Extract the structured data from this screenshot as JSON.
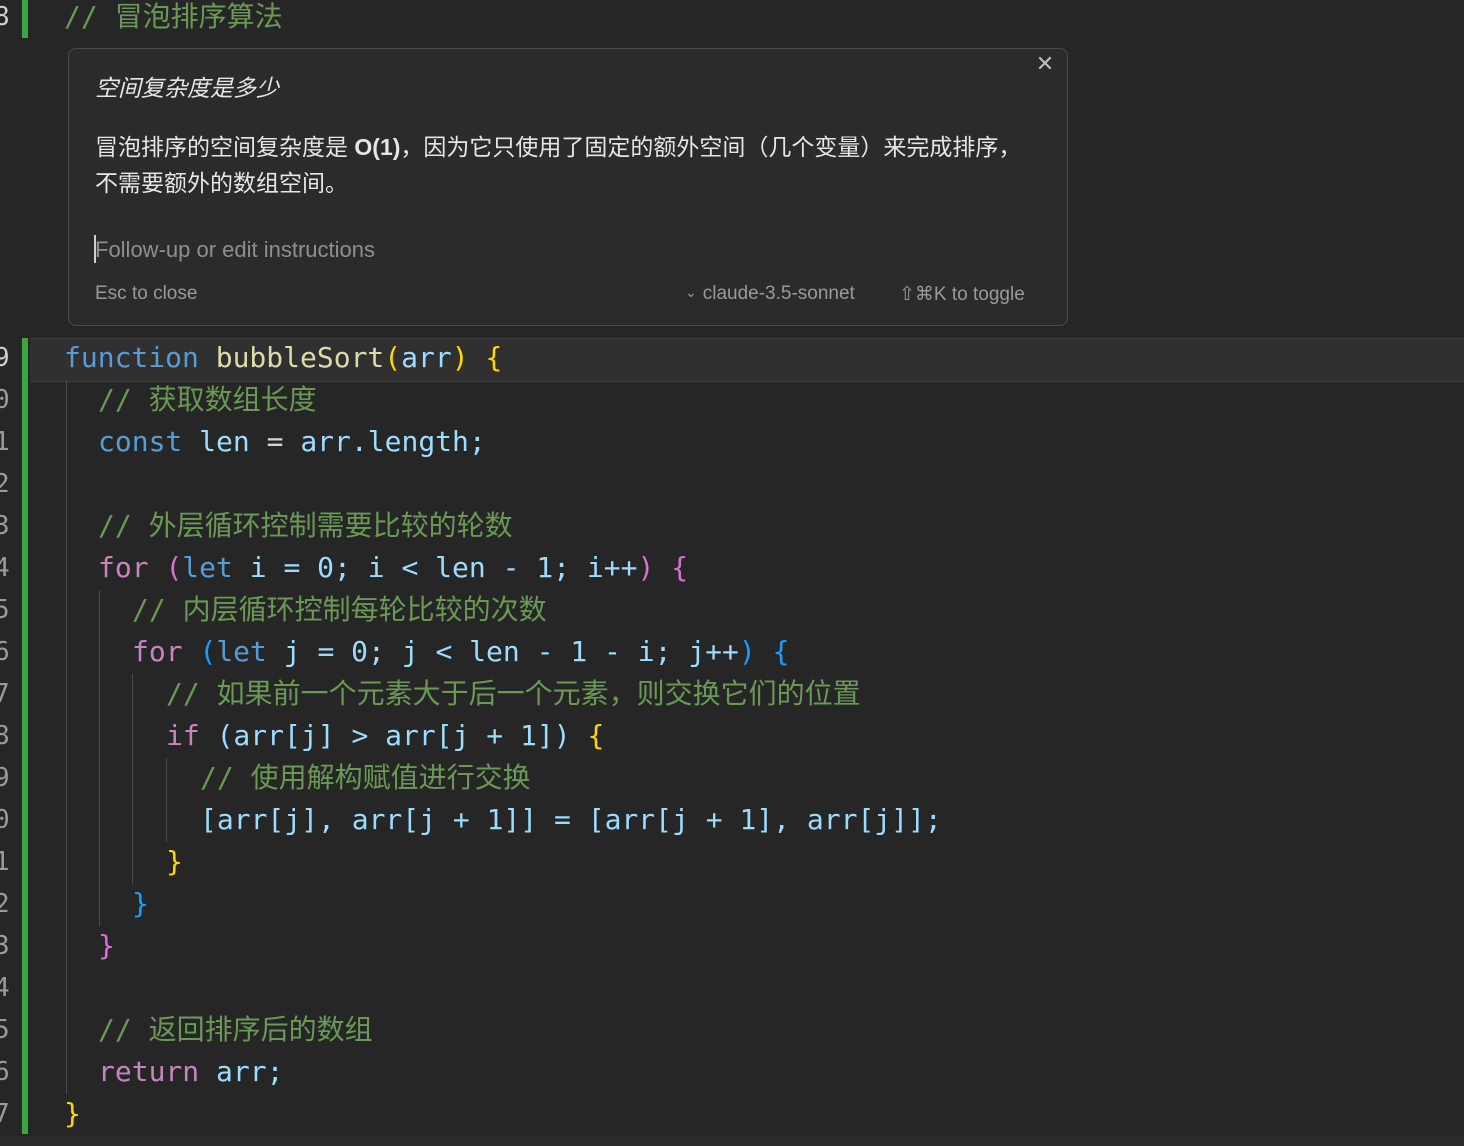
{
  "editor": {
    "header_line": {
      "number": "8",
      "comment": "// 冒泡排序算法"
    },
    "line_numbers": [
      "9",
      "0",
      "1",
      "2",
      "3",
      "4",
      "5",
      "6",
      "7",
      "8",
      "9",
      "0",
      "1",
      "2",
      "3",
      "4",
      "5",
      "6",
      "7"
    ],
    "code": {
      "l1": {
        "kw": "function",
        "name": "bubbleSort",
        "open": "(",
        "param": "arr",
        "close": ")",
        "brace": "{"
      },
      "l2": {
        "comment": "// 获取数组长度"
      },
      "l3": {
        "kw": "const",
        "var": "len",
        "eq": "=",
        "obj": "arr",
        "prop": ".length;"
      },
      "l5": {
        "comment": "// 外层循环控制需要比较的轮数"
      },
      "l6": {
        "kw": "for",
        "p1": "(",
        "let": "let",
        "rest": "i = 0; i < ",
        "len": "len",
        "rest2": " - 1; i++",
        "p2": ")",
        "brace": "{"
      },
      "l7": {
        "comment": "// 内层循环控制每轮比较的次数"
      },
      "l8": {
        "kw": "for",
        "p1": "(",
        "let": "let",
        "rest": "j = 0; j < ",
        "len": "len",
        "rest2": " - 1 - i; j++",
        "p2": ")",
        "brace": "{"
      },
      "l9": {
        "comment": "// 如果前一个元素大于后一个元素，则交换它们的位置"
      },
      "l10": {
        "kw": "if",
        "text": "(arr[j] > arr[j + 1])",
        "brace": "{"
      },
      "l11": {
        "comment": "// 使用解构赋值进行交换"
      },
      "l12": {
        "text": "[arr[j], arr[j + 1]] = [arr[j + 1], arr[j]];"
      },
      "l13": {
        "brace": "}"
      },
      "l14": {
        "brace": "}"
      },
      "l15": {
        "brace": "}"
      },
      "l17": {
        "comment": "// 返回排序后的数组"
      },
      "l18": {
        "kw": "return",
        "rest": "arr;"
      },
      "l19": {
        "brace": "}"
      }
    }
  },
  "popup": {
    "question": "空间复杂度是多少",
    "answer_pre": "冒泡排序的空间复杂度是 ",
    "answer_bold": "O(1)",
    "answer_post": "，因为它只使用了固定的额外空间（几个变量）来完成排序，不需要额外的数组空间。",
    "input_placeholder": "Follow-up or edit instructions",
    "input_value": "",
    "esc_hint": "Esc to close",
    "model": "claude-3.5-sonnet",
    "toggle_hint": "⇧⌘K to toggle",
    "close_glyph": "✕"
  },
  "colors": {
    "background": "#262626",
    "comment": "#6a9955",
    "keyword": "#569cd6",
    "control_keyword": "#c586c0",
    "function_name": "#dcdcaa",
    "variable": "#9cdcfe",
    "number": "#b5cea8",
    "diff_added": "#3aa63f"
  }
}
